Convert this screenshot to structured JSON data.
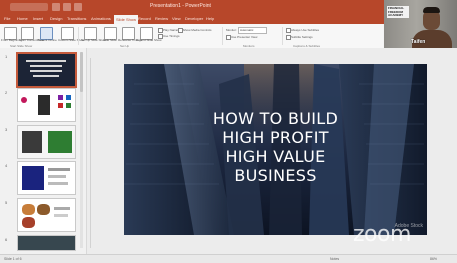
{
  "titlebar": {
    "document_title": "Presentation1 - PowerPoint",
    "bg_color": "#b7472a"
  },
  "menu": {
    "tabs": [
      "File",
      "Home",
      "Insert",
      "Design",
      "Transitions",
      "Animations",
      "Slide Show",
      "Record",
      "Review",
      "View",
      "Developer",
      "Help"
    ],
    "active_index": 6
  },
  "ribbon": {
    "buttons": [
      {
        "label": "From Beginning",
        "icon": "play-icon"
      },
      {
        "label": "From Current Slide",
        "icon": "play-current-icon"
      },
      {
        "label": "Present Online",
        "icon": "present-online-icon"
      },
      {
        "label": "Custom Slide Show",
        "icon": "custom-show-icon"
      },
      {
        "label": "Set Up Slide Show",
        "icon": "setup-show-icon"
      },
      {
        "label": "Hide Slide",
        "icon": "hide-slide-icon"
      },
      {
        "label": "Rehearse Timings",
        "icon": "timer-icon"
      },
      {
        "label": "Record Slide Show",
        "icon": "record-icon"
      }
    ],
    "checkboxes": [
      "Play Narrations",
      "Use Timings",
      "Show Media Controls"
    ],
    "monitor_label": "Monitor:",
    "monitor_value": "Automatic",
    "use_presenter_view": "Use Presenter View",
    "subtitle_settings": "Subtitle Settings",
    "always_use_subtitles": "Always Use Subtitles",
    "groups": [
      "Start Slide Show",
      "Set Up",
      "Monitors",
      "Captions & Subtitles"
    ]
  },
  "webcam": {
    "participant_name": "Taifen",
    "logo_text": "FINANCIAL FREEDOM ACADEMY"
  },
  "slide_panel": {
    "slides": [
      {
        "num": "1",
        "selected": true
      },
      {
        "num": "2",
        "selected": false
      },
      {
        "num": "3",
        "selected": false
      },
      {
        "num": "4",
        "selected": false
      },
      {
        "num": "5",
        "selected": false
      },
      {
        "num": "6",
        "selected": false
      }
    ]
  },
  "slide": {
    "title_line1": "HOW TO BUILD",
    "title_line2": "HIGH PROFIT",
    "title_line3": "HIGH VALUE",
    "title_line4": "BUSINESS",
    "watermark": "Adobe Stock"
  },
  "overlay": {
    "zoom_brand": "zoom"
  },
  "statusbar": {
    "slide_count": "Slide 1 of 6",
    "notes": "Notes",
    "zoom_level": "86%"
  }
}
